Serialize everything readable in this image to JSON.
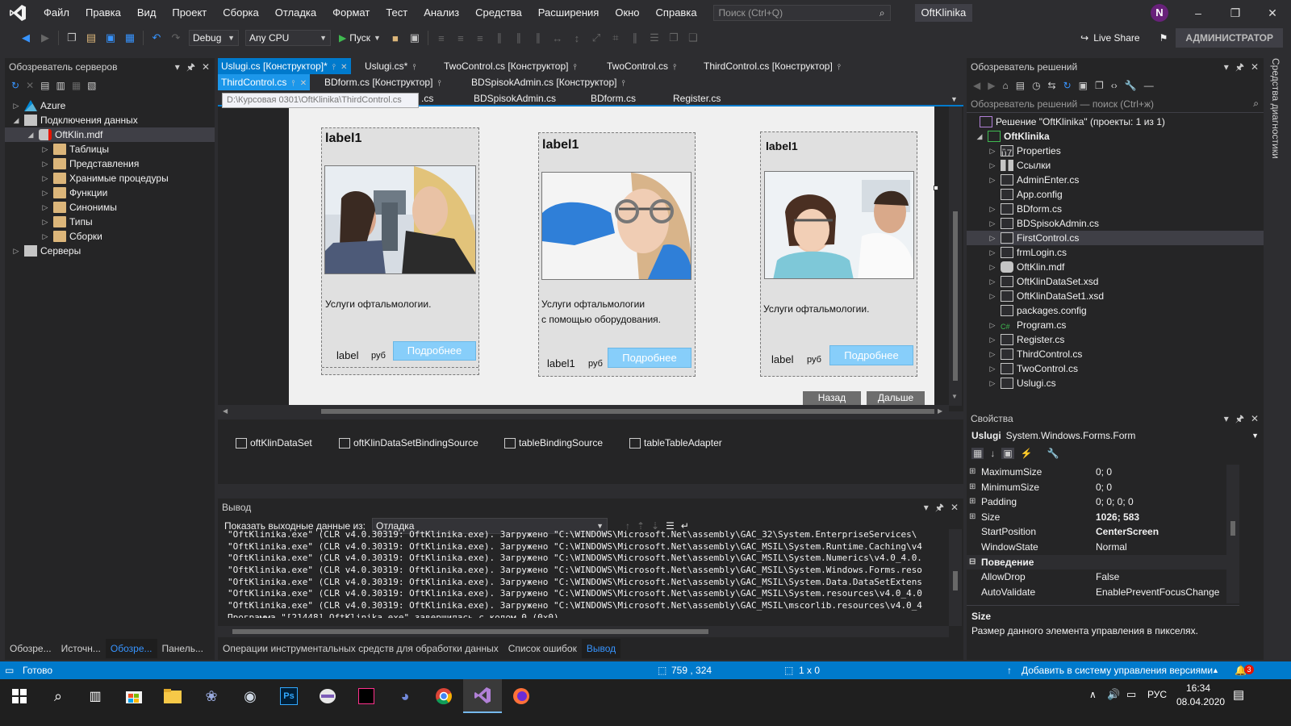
{
  "menubar": {
    "items": [
      "Файл",
      "Правка",
      "Вид",
      "Проект",
      "Сборка",
      "Отладка",
      "Формат",
      "Тест",
      "Анализ",
      "Средства",
      "Расширения",
      "Окно",
      "Справка"
    ],
    "search_placeholder": "Поиск (Ctrl+Q)",
    "project_title": "OftKlinika",
    "avatar_letter": "N"
  },
  "toolbar": {
    "config": "Debug",
    "platform": "Any CPU",
    "start": "Пуск",
    "live_share": "Live Share",
    "admin": "АДМИНИСТРАТОР"
  },
  "server_explorer": {
    "title": "Обозреватель серверов",
    "items": [
      {
        "label": "Azure"
      },
      {
        "label": "Подключения данных"
      },
      {
        "label": "OftKlin.mdf"
      },
      {
        "label": "Таблицы"
      },
      {
        "label": "Представления"
      },
      {
        "label": "Хранимые процедуры"
      },
      {
        "label": "Функции"
      },
      {
        "label": "Синонимы"
      },
      {
        "label": "Типы"
      },
      {
        "label": "Сборки"
      },
      {
        "label": "Серверы"
      }
    ],
    "bottom_tabs": [
      "Обозре...",
      "Источн...",
      "Обозре...",
      "Панель..."
    ]
  },
  "doc_tabs": {
    "row1": [
      "Uslugi.cs [Конструктор]*",
      "Uslugi.cs*",
      "TwoControl.cs [Конструктор]",
      "TwoControl.cs",
      "ThirdControl.cs [Конструктор]"
    ],
    "row2": [
      "ThirdControl.cs",
      "BDform.cs [Конструктор]",
      "BDSpisokAdmin.cs [Конструктор]"
    ],
    "row3": [
      ".cs",
      "BDSpisokAdmin.cs",
      "BDform.cs",
      "Register.cs"
    ],
    "tooltip": "D:\\Курсовая 0301\\OftKlinika\\ThirdControl.cs"
  },
  "designer": {
    "cards": [
      {
        "title": "label1",
        "text1": "Услуги офтальмологии.",
        "text2": "",
        "price": "label",
        "currency": "руб",
        "button": "Подробнее"
      },
      {
        "title": "label1",
        "text1": "Услуги офтальмологии",
        "text2": "с помощью оборудования.",
        "price": "label1",
        "currency": "руб",
        "button": "Подробнее"
      },
      {
        "title": "label1",
        "text1": "Услуги офтальмологии.",
        "text2": "",
        "price": "label",
        "currency": "руб",
        "button": "Подробнее"
      }
    ],
    "back_button": "Назад",
    "next_button": "Дальше",
    "components": [
      "oftKlinDataSet",
      "oftKlinDataSetBindingSource",
      "tableBindingSource",
      "tableTableAdapter"
    ]
  },
  "output": {
    "title": "Вывод",
    "show_label": "Показать выходные данные из:",
    "source": "Отладка",
    "lines": [
      "\"OftKlinika.exe\" (CLR v4.0.30319: OftKlinika.exe). Загружено \"C:\\WINDOWS\\Microsoft.Net\\assembly\\GAC_32\\System.EnterpriseServices\\",
      "\"OftKlinika.exe\" (CLR v4.0.30319: OftKlinika.exe). Загружено \"C:\\WINDOWS\\Microsoft.Net\\assembly\\GAC_MSIL\\System.Runtime.Caching\\v4",
      "\"OftKlinika.exe\" (CLR v4.0.30319: OftKlinika.exe). Загружено \"C:\\WINDOWS\\Microsoft.Net\\assembly\\GAC_MSIL\\System.Numerics\\v4.0_4.0.",
      "\"OftKlinika.exe\" (CLR v4.0.30319: OftKlinika.exe). Загружено \"C:\\WINDOWS\\Microsoft.Net\\assembly\\GAC_MSIL\\System.Windows.Forms.reso",
      "\"OftKlinika.exe\" (CLR v4.0.30319: OftKlinika.exe). Загружено \"C:\\WINDOWS\\Microsoft.Net\\assembly\\GAC_MSIL\\System.Data.DataSetExtens",
      "\"OftKlinika.exe\" (CLR v4.0.30319: OftKlinika.exe). Загружено \"C:\\WINDOWS\\Microsoft.Net\\assembly\\GAC_MSIL\\System.resources\\v4.0_4.0",
      "\"OftKlinika.exe\" (CLR v4.0.30319: OftKlinika.exe). Загружено \"C:\\WINDOWS\\Microsoft.Net\\assembly\\GAC_MSIL\\mscorlib.resources\\v4.0_4",
      "Программа \"[21448] OftKlinika.exe\" завершилась с кодом 0 (0x0)."
    ],
    "bottom_tabs": [
      "Операции инструментальных средств для обработки данных",
      "Список ошибок",
      "Вывод"
    ]
  },
  "solution_explorer": {
    "title": "Обозреватель решений",
    "search_placeholder": "Обозреватель решений — поиск (Ctrl+ж)",
    "solution": "Решение \"OftKlinika\" (проекты: 1 из 1)",
    "project": "OftKlinika",
    "items": [
      {
        "label": "Properties"
      },
      {
        "label": "Ссылки"
      },
      {
        "label": "AdminEnter.cs"
      },
      {
        "label": "App.config"
      },
      {
        "label": "BDform.cs"
      },
      {
        "label": "BDSpisokAdmin.cs"
      },
      {
        "label": "FirstControl.cs"
      },
      {
        "label": "frmLogin.cs"
      },
      {
        "label": "OftKlin.mdf"
      },
      {
        "label": "OftKlinDataSet.xsd"
      },
      {
        "label": "OftKlinDataSet1.xsd"
      },
      {
        "label": "packages.config"
      },
      {
        "label": "Program.cs"
      },
      {
        "label": "Register.cs"
      },
      {
        "label": "ThirdControl.cs"
      },
      {
        "label": "TwoControl.cs"
      },
      {
        "label": "Uslugi.cs"
      }
    ],
    "side_label": "Средства диагностики"
  },
  "properties": {
    "title": "Свойства",
    "object_name": "Uslugi",
    "object_type": "System.Windows.Forms.Form",
    "rows": [
      {
        "name": "MaximumSize",
        "value": "0; 0",
        "bold": false
      },
      {
        "name": "MinimumSize",
        "value": "0; 0",
        "bold": false
      },
      {
        "name": "Padding",
        "value": "0; 0; 0; 0",
        "bold": false
      },
      {
        "name": "Size",
        "value": "1026; 583",
        "bold": true
      },
      {
        "name": "StartPosition",
        "value": "CenterScreen",
        "bold": true
      },
      {
        "name": "WindowState",
        "value": "Normal",
        "bold": false
      },
      {
        "name": "Поведение",
        "value": "",
        "bold": true
      },
      {
        "name": "AllowDrop",
        "value": "False",
        "bold": false
      },
      {
        "name": "AutoValidate",
        "value": "EnablePreventFocusChange",
        "bold": false
      }
    ],
    "desc_title": "Size",
    "desc_text": "Размер данного элемента управления в пикселях."
  },
  "statusbar": {
    "ready": "Готово",
    "position": "759 , 324",
    "selection": "1 x 0",
    "source_control": "Добавить в систему управления версиями",
    "notifications": "3"
  },
  "taskbar": {
    "lang": "РУС",
    "time": "16:34",
    "date": "08.04.2020"
  },
  "colors": {
    "accent": "#007acc",
    "card_button": "#87cefa",
    "folder": "#dcb67a"
  }
}
